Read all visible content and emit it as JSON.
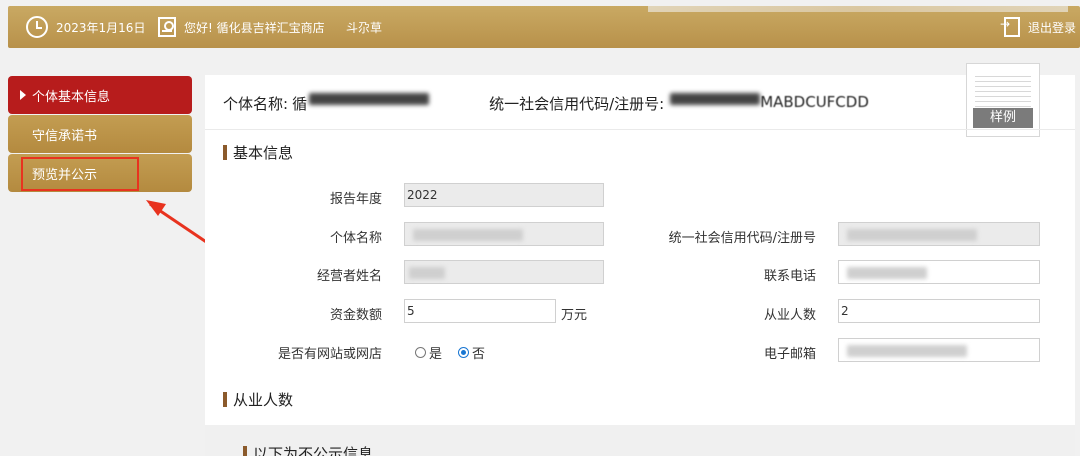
{
  "topbar": {
    "date": "2023年1月16日",
    "greeting": "您好! 循化县吉祥汇宝商店",
    "user": "斗尕草",
    "logout": "退出登录"
  },
  "sidebar": {
    "items": [
      {
        "label": "个体基本信息",
        "active": true
      },
      {
        "label": "守信承诺书",
        "active": false
      },
      {
        "label": "预览并公示",
        "active": false
      }
    ]
  },
  "header": {
    "name_label": "个体名称:",
    "name_value": "循",
    "code_label": "统一社会信用代码/注册号:",
    "code_value": "MABDCUFCDD"
  },
  "sample": {
    "label": "样例"
  },
  "basic": {
    "title": "基本信息",
    "year_label": "报告年度",
    "year_value": "2022",
    "name_label": "个体名称",
    "code_label": "统一社会信用代码/注册号",
    "operator_label": "经营者姓名",
    "phone_label": "联系电话",
    "capital_label": "资金数额",
    "capital_value": "5",
    "capital_unit": "万元",
    "employees_label": "从业人数",
    "employees_value": "2",
    "website_label": "是否有网站或网店",
    "radio_yes": "是",
    "radio_no": "否",
    "email_label": "电子邮箱"
  },
  "employees_section": {
    "title": "从业人数"
  },
  "nonpublic_section": {
    "title": "以下为不公示信息"
  }
}
